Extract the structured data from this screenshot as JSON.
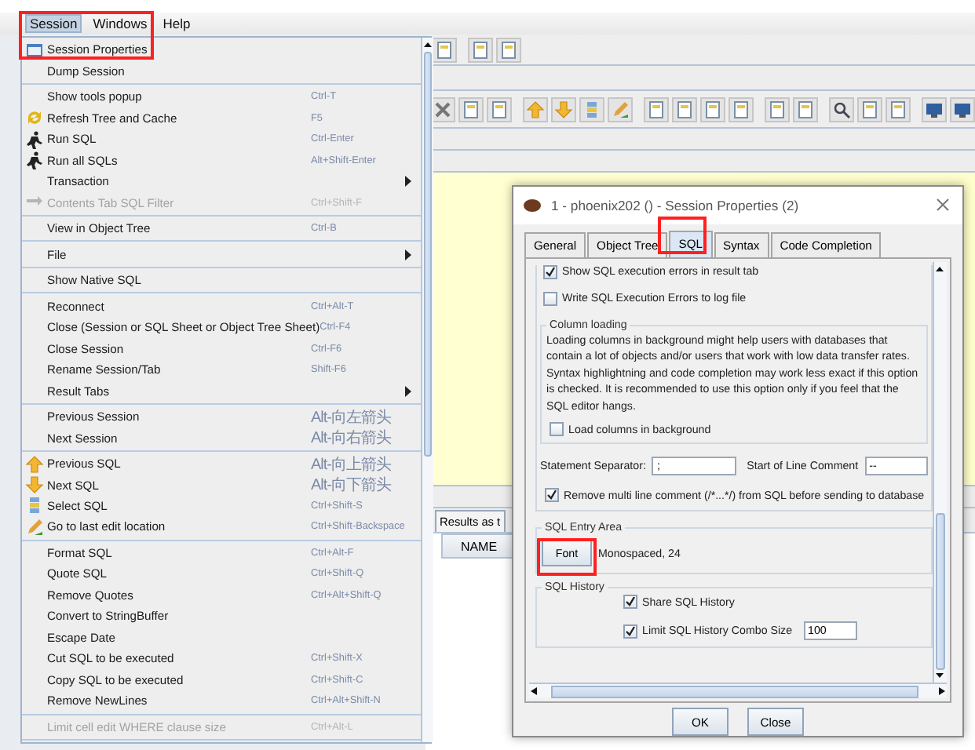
{
  "menu_bar": [
    {
      "label": "Session",
      "selected": true
    },
    {
      "label": "Windows",
      "selected": false
    },
    {
      "label": "Help",
      "selected": false
    }
  ],
  "session_menu": {
    "groups": [
      [
        {
          "label": "Session Properties",
          "disabled": false,
          "submenu": false
        },
        {
          "label": "Dump Session",
          "disabled": false,
          "submenu": false
        }
      ],
      [
        {
          "label": "Show tools popup",
          "shortcut": "Ctrl-T",
          "disabled": false,
          "submenu": false
        },
        {
          "label": "Refresh Tree and Cache",
          "shortcut": "F5",
          "disabled": false,
          "submenu": false
        },
        {
          "label": "Run SQL",
          "shortcut": "Ctrl-Enter",
          "disabled": false,
          "submenu": false
        },
        {
          "label": "Run all SQLs",
          "shortcut": "Alt+Shift-Enter",
          "disabled": false,
          "submenu": false
        },
        {
          "label": "Transaction",
          "disabled": false,
          "submenu": true
        },
        {
          "label": "Contents Tab SQL Filter",
          "shortcut": "Ctrl+Shift-F",
          "disabled": true,
          "submenu": false
        }
      ],
      [
        {
          "label": "View in Object Tree",
          "shortcut": "Ctrl-B",
          "disabled": false,
          "submenu": false
        }
      ],
      [
        {
          "label": "File",
          "disabled": false,
          "submenu": true
        }
      ],
      [
        {
          "label": "Show Native SQL",
          "disabled": false,
          "submenu": false
        }
      ],
      [
        {
          "label": "Reconnect",
          "shortcut": "Ctrl+Alt-T",
          "disabled": false,
          "submenu": false
        },
        {
          "label": "Close (Session or SQL Sheet or Object Tree Sheet)",
          "shortcut": "Ctrl-F4",
          "disabled": false,
          "submenu": false
        },
        {
          "label": "Close Session",
          "shortcut": "Ctrl-F6",
          "disabled": false,
          "submenu": false
        },
        {
          "label": "Rename Session/Tab",
          "shortcut": "Shift-F6",
          "disabled": false,
          "submenu": false
        },
        {
          "label": "Result Tabs",
          "disabled": false,
          "submenu": true
        }
      ],
      [
        {
          "label": "Previous Session",
          "shortcut": "Alt-向左箭头",
          "disabled": false,
          "submenu": false
        },
        {
          "label": "Next Session",
          "shortcut": "Alt-向右箭头",
          "disabled": false,
          "submenu": false
        }
      ],
      [
        {
          "label": "Previous SQL",
          "shortcut": "Alt-向上箭头",
          "disabled": false,
          "submenu": false
        },
        {
          "label": "Next SQL",
          "shortcut": "Alt-向下箭头",
          "disabled": false,
          "submenu": false
        },
        {
          "label": "Select SQL",
          "shortcut": "Ctrl+Shift-S",
          "disabled": false,
          "submenu": false
        },
        {
          "label": "Go to last edit location",
          "shortcut": "Ctrl+Shift-Backspace",
          "disabled": false,
          "submenu": false
        }
      ],
      [
        {
          "label": "Format SQL",
          "shortcut": "Ctrl+Alt-F",
          "disabled": false,
          "submenu": false
        },
        {
          "label": "Quote SQL",
          "shortcut": "Ctrl+Shift-Q",
          "disabled": false,
          "submenu": false
        },
        {
          "label": "Remove Quotes",
          "shortcut": "Ctrl+Alt+Shift-Q",
          "disabled": false,
          "submenu": false
        },
        {
          "label": "Convert to StringBuffer",
          "disabled": false,
          "submenu": false
        },
        {
          "label": "Escape Date",
          "disabled": false,
          "submenu": false
        },
        {
          "label": "Cut SQL to be executed",
          "shortcut": "Ctrl+Shift-X",
          "disabled": false,
          "submenu": false
        },
        {
          "label": "Copy SQL to be executed",
          "shortcut": "Ctrl+Shift-C",
          "disabled": false,
          "submenu": false
        },
        {
          "label": "Remove NewLines",
          "shortcut": "Ctrl+Alt+Shift-N",
          "disabled": false,
          "submenu": false
        }
      ],
      [
        {
          "label": "Limit cell edit WHERE clause size",
          "shortcut": "Ctrl+Alt-L",
          "disabled": true,
          "submenu": false
        }
      ]
    ]
  },
  "results": {
    "tab": "Results as t",
    "column_header": "NAME"
  },
  "dialog": {
    "title": "1 - phoenix202 () - Session Properties (2)",
    "tabs": [
      {
        "label": "General",
        "selected": false
      },
      {
        "label": "Object Tree",
        "selected": false
      },
      {
        "label": "SQL",
        "selected": true
      },
      {
        "label": "Syntax",
        "selected": false
      },
      {
        "label": "Code Completion",
        "selected": false
      }
    ],
    "top_checks": [
      {
        "label": "Show SQL execution errors in result tab",
        "checked": true
      },
      {
        "label": "Write SQL Execution Errors to log file",
        "checked": false
      }
    ],
    "column_loading": {
      "title": "Column loading",
      "description": "Loading columns in background might help users with databases that contain a lot of objects and/or users that work with low data transfer rates. Syntax highlightning and code completion may work less exact if this option is checked. It is recommended to use this option only if you feel that the SQL editor hangs.",
      "checkbox": {
        "label": "Load columns in background",
        "checked": false
      }
    },
    "separators": {
      "statement_label": "Statement Separator:",
      "statement_value": ";",
      "comment_label": "Start of Line Comment",
      "comment_value": "--"
    },
    "remove_comments": {
      "label": "Remove multi line comment (/*...*/) from SQL before sending to database",
      "checked": true
    },
    "entry_area": {
      "title": "SQL Entry Area",
      "font_button": "Font",
      "font_value": "Monospaced, 24"
    },
    "history": {
      "title": "SQL History",
      "share": {
        "label": "Share SQL History",
        "checked": true
      },
      "limit": {
        "label": "Limit SQL History Combo Size",
        "checked": true
      },
      "limit_value": "100"
    },
    "buttons": [
      "OK",
      "Close"
    ]
  }
}
